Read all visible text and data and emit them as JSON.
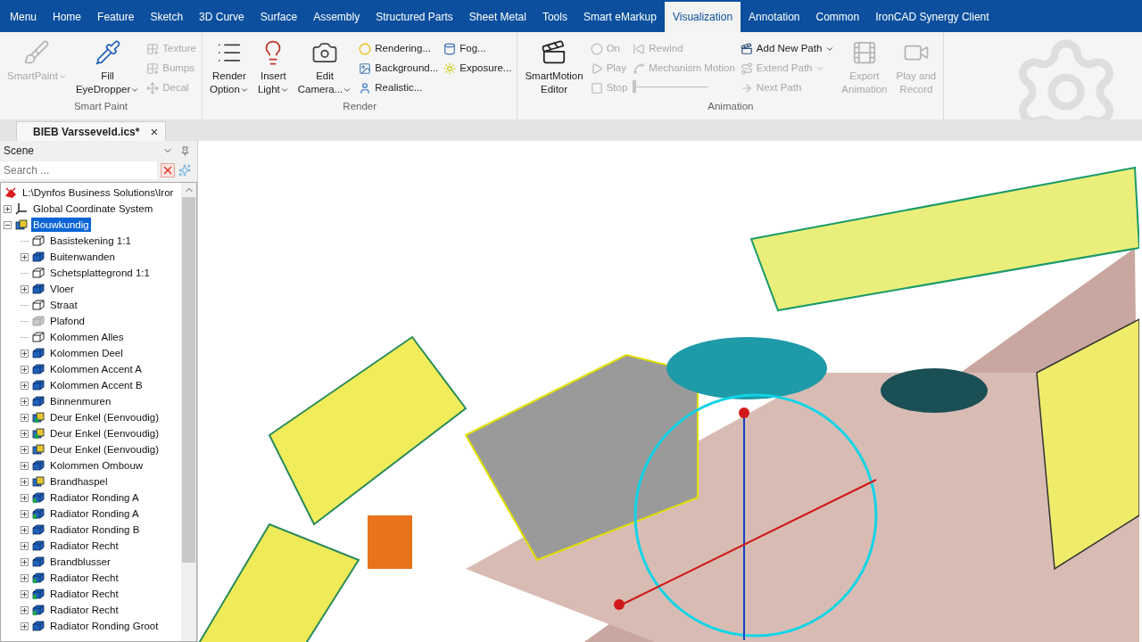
{
  "menu_tabs": [
    {
      "label": "Menu",
      "selected": false
    },
    {
      "label": "Home",
      "selected": false
    },
    {
      "label": "Feature",
      "selected": false
    },
    {
      "label": "Sketch",
      "selected": false
    },
    {
      "label": "3D Curve",
      "selected": false
    },
    {
      "label": "Surface",
      "selected": false
    },
    {
      "label": "Assembly",
      "selected": false
    },
    {
      "label": "Structured Parts",
      "selected": false
    },
    {
      "label": "Sheet Metal",
      "selected": false
    },
    {
      "label": "Tools",
      "selected": false
    },
    {
      "label": "Smart eMarkup",
      "selected": false
    },
    {
      "label": "Visualization",
      "selected": true
    },
    {
      "label": "Annotation",
      "selected": false
    },
    {
      "label": "Common",
      "selected": false
    },
    {
      "label": "IronCAD Synergy Client",
      "selected": false
    }
  ],
  "ribbon_groups": [
    {
      "label": "Smart Paint",
      "controls": [
        {
          "kind": "large",
          "lines": [
            "SmartPaint"
          ],
          "disabled": true,
          "dropdown": true
        },
        {
          "kind": "large",
          "lines": [
            "Fill",
            "EyeDropper"
          ],
          "disabled": false,
          "dropdown": true
        },
        {
          "kind": "column",
          "items": [
            {
              "kind": "small",
              "label": "Texture",
              "disabled": true
            },
            {
              "kind": "small",
              "label": "Bumps",
              "disabled": true
            },
            {
              "kind": "small",
              "label": "Decal",
              "disabled": true
            }
          ]
        }
      ]
    },
    {
      "label": "Render",
      "controls": [
        {
          "kind": "large",
          "lines": [
            "Render",
            "Option"
          ],
          "disabled": false,
          "dropdown": true
        },
        {
          "kind": "large",
          "lines": [
            "Insert",
            "Light"
          ],
          "disabled": false,
          "dropdown": true
        },
        {
          "kind": "large",
          "lines": [
            "Edit",
            "Camera..."
          ],
          "disabled": false,
          "dropdown": true
        },
        {
          "kind": "column",
          "items": [
            {
              "kind": "small",
              "label": "Rendering...",
              "disabled": false
            },
            {
              "kind": "small",
              "label": "Background...",
              "disabled": false
            },
            {
              "kind": "small",
              "label": "Realistic...",
              "disabled": false
            }
          ]
        },
        {
          "kind": "column",
          "items": [
            {
              "kind": "small",
              "label": "Fog...",
              "disabled": false
            },
            {
              "kind": "small",
              "label": "Exposure...",
              "disabled": false
            }
          ]
        }
      ]
    },
    {
      "label": "Animation",
      "controls": [
        {
          "kind": "large",
          "lines": [
            "SmartMotion",
            "Editor"
          ],
          "disabled": false,
          "dropdown": false
        },
        {
          "kind": "column",
          "items": [
            {
              "kind": "small",
              "label": "On",
              "disabled": true
            },
            {
              "kind": "small",
              "label": "Play",
              "disabled": true
            },
            {
              "kind": "small",
              "label": "Stop",
              "disabled": true
            }
          ]
        },
        {
          "kind": "column",
          "items": [
            {
              "kind": "small",
              "label": "Rewind",
              "disabled": true
            },
            {
              "kind": "small",
              "label": "Mechanism Motion",
              "disabled": true
            },
            {
              "kind": "slider",
              "level": 0
            }
          ]
        },
        {
          "kind": "column",
          "items": [
            {
              "kind": "small",
              "label": "Add New Path",
              "disabled": false,
              "dropdown": true
            },
            {
              "kind": "small",
              "label": "Extend Path",
              "disabled": true,
              "dropdown": true
            },
            {
              "kind": "small",
              "label": "Next Path",
              "disabled": true
            }
          ]
        },
        {
          "kind": "large",
          "lines": [
            "Export",
            "Animation"
          ],
          "disabled": true,
          "dropdown": false
        },
        {
          "kind": "large",
          "lines": [
            "Play and",
            "Record"
          ],
          "disabled": true,
          "dropdown": false
        }
      ]
    }
  ],
  "document_tab": {
    "label": "BIEB Varsseveld.ics*",
    "close": "×"
  },
  "scene_panel": {
    "title": "Scene",
    "search": {
      "placeholder": "Search ..."
    },
    "tree": [
      {
        "label": "L:\\Dynfos Business Solutions\\Iror",
        "kind": "root",
        "selected": false,
        "children": [
          {
            "label": "Global Coordinate System",
            "kind": "axes",
            "selected": false,
            "expanded": false,
            "expandable": true
          },
          {
            "label": "Bouwkundig",
            "kind": "assembly",
            "selected": true,
            "expanded": true,
            "expandable": true,
            "children": [
              {
                "label": "Basistekening 1:1",
                "kind": "sketch",
                "selected": false,
                "expandable": false
              },
              {
                "label": "Buitenwanden",
                "kind": "part",
                "selected": false,
                "expandable": true
              },
              {
                "label": "Schetsplattegrond 1:1",
                "kind": "sketch",
                "selected": false,
                "expandable": false
              },
              {
                "label": "Vloer",
                "kind": "part",
                "selected": false,
                "expandable": true
              },
              {
                "label": "Straat",
                "kind": "sketch",
                "selected": false,
                "expandable": false
              },
              {
                "label": "Plafond",
                "kind": "hidden",
                "selected": false,
                "expandable": false
              },
              {
                "label": "Kolommen Alles",
                "kind": "sketch",
                "selected": false,
                "expandable": false
              },
              {
                "label": "Kolommen Deel",
                "kind": "part",
                "selected": false,
                "expandable": true
              },
              {
                "label": "Kolommen Accent A",
                "kind": "part",
                "selected": false,
                "expandable": true
              },
              {
                "label": "Kolommen Accent B",
                "kind": "part",
                "selected": false,
                "expandable": true
              },
              {
                "label": "Binnenmuren",
                "kind": "part",
                "selected": false,
                "expandable": true
              },
              {
                "label": "Deur Enkel (Eenvoudig)",
                "kind": "door",
                "selected": false,
                "expandable": true
              },
              {
                "label": "Deur Enkel (Eenvoudig)",
                "kind": "door",
                "selected": false,
                "expandable": true
              },
              {
                "label": "Deur Enkel (Eenvoudig)",
                "kind": "assembly",
                "selected": false,
                "expandable": true
              },
              {
                "label": "Kolommen Ombouw",
                "kind": "part",
                "selected": false,
                "expandable": true
              },
              {
                "label": "Brandhaspel",
                "kind": "assembly",
                "selected": false,
                "expandable": true
              },
              {
                "label": "Radiator Ronding A",
                "kind": "radiator",
                "selected": false,
                "expandable": true
              },
              {
                "label": "Radiator Ronding A",
                "kind": "radiator",
                "selected": false,
                "expandable": true
              },
              {
                "label": "Radiator Ronding B",
                "kind": "part",
                "selected": false,
                "expandable": true
              },
              {
                "label": "Radiator Recht",
                "kind": "part",
                "selected": false,
                "expandable": true
              },
              {
                "label": "Brandblusser",
                "kind": "part",
                "selected": false,
                "expandable": true
              },
              {
                "label": "Radiator Recht",
                "kind": "radiator",
                "selected": false,
                "expandable": true
              },
              {
                "label": "Radiator Recht",
                "kind": "radiator",
                "selected": false,
                "expandable": true
              },
              {
                "label": "Radiator Recht",
                "kind": "radiator",
                "selected": false,
                "expandable": true
              },
              {
                "label": "Radiator Ronding Groot",
                "kind": "part",
                "selected": false,
                "expandable": true
              }
            ]
          }
        ]
      }
    ]
  }
}
